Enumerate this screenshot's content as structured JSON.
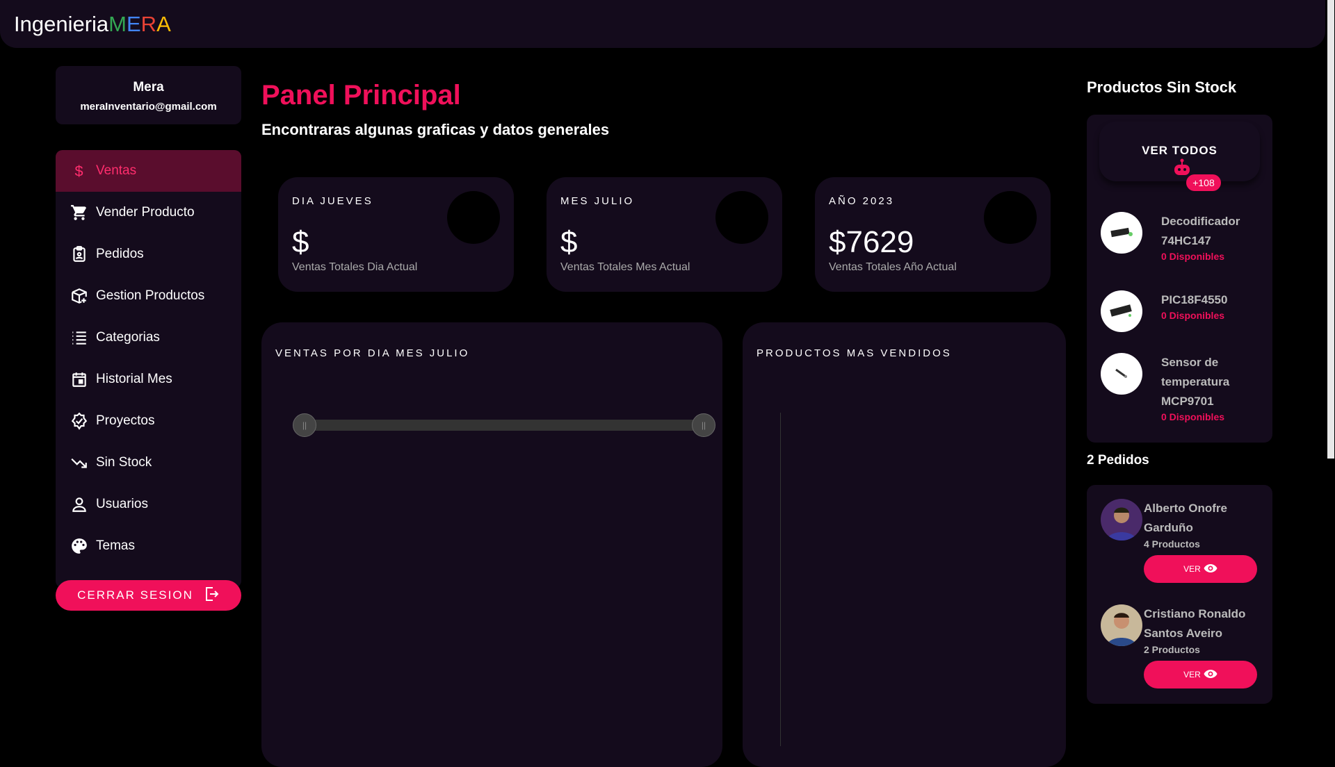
{
  "brand": {
    "prefix": "Ingenieria",
    "letters": [
      "M",
      "E",
      "R",
      "A"
    ],
    "letter_colors": [
      "#34a853",
      "#4285f4",
      "#ea4335",
      "#fbbc05"
    ]
  },
  "colors": {
    "accent": "#f0105a",
    "panel": "#140b1c",
    "background": "#000000"
  },
  "profile": {
    "name": "Mera",
    "email": "meraInventario@gmail.com"
  },
  "menu": [
    {
      "label": "Ventas",
      "icon": "dollar-icon",
      "active": true
    },
    {
      "label": "Vender Producto",
      "icon": "cart-icon"
    },
    {
      "label": "Pedidos",
      "icon": "clipboard-person-icon"
    },
    {
      "label": "Gestion Productos",
      "icon": "box-add-icon"
    },
    {
      "label": "Categorias",
      "icon": "list-icon"
    },
    {
      "label": "Historial Mes",
      "icon": "calendar-icon"
    },
    {
      "label": "Proyectos",
      "icon": "verified-icon"
    },
    {
      "label": "Sin Stock",
      "icon": "trending-down-icon"
    },
    {
      "label": "Usuarios",
      "icon": "person-icon"
    },
    {
      "label": "Temas",
      "icon": "palette-icon"
    }
  ],
  "logout_label": "CERRAR SESION",
  "main": {
    "title": "Panel Principal",
    "subtitle": "Encontraras algunas graficas y datos generales",
    "stats": [
      {
        "label": "DIA JUEVES",
        "value": "$",
        "caption": "Ventas Totales Dia Actual"
      },
      {
        "label": "MES JULIO",
        "value": "$",
        "caption": "Ventas Totales Mes Actual"
      },
      {
        "label": "AÑO 2023",
        "value": "$7629",
        "caption": "Ventas Totales Año Actual"
      }
    ],
    "chart1_label": "VENTAS POR DIA MES JULIO",
    "chart2_label": "PRODUCTOS MAS VENDIDOS"
  },
  "right": {
    "nostock_title": "Productos Sin Stock",
    "ver_todos": "VER TODOS",
    "badge": "+108",
    "products": [
      {
        "name": "Decodificador 74HC147",
        "avail": "0 Disponibles"
      },
      {
        "name": "PIC18F4550",
        "avail": "0 Disponibles"
      },
      {
        "name": "Sensor de temperatura MCP9701",
        "avail": "0 Disponibles"
      }
    ],
    "orders_title": "2 Pedidos",
    "orders": [
      {
        "name": "Alberto Onofre Garduño",
        "count": "4 Productos",
        "button": "VER"
      },
      {
        "name": "Cristiano Ronaldo Santos Aveiro",
        "count": "2 Productos",
        "button": "VER"
      }
    ]
  }
}
